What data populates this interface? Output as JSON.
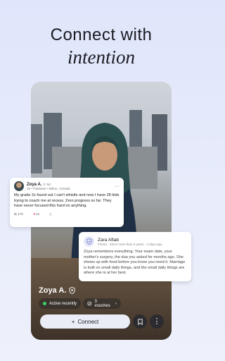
{
  "headline": {
    "line1": "Connect with",
    "line2": "intention"
  },
  "post": {
    "author": "Zoya A.",
    "time": "5d",
    "meta": "25 • Pakistani • Milton, Canada",
    "body": "My grade 2s found out I can't whistle and now I have 28 kids trying to coach me at recess. Zero progress so far. They have never focused this hard on anything.",
    "views": "17K",
    "likes": "61"
  },
  "comment": {
    "author": "Zara Aftab",
    "meta": "Friend · Since more than 5 years · 4 days ago",
    "body": "Zoya remembers everything. Your exam date, your mother's surgery, the dua you asked for months ago. She shows up with food before you know you need it. Marriage is built on small daily things, and the small daily things are where she is at her best."
  },
  "profile": {
    "name": "Zoya A.",
    "status": "Active recently",
    "vouches": "3 vouches",
    "status_color": "#3ad46a"
  },
  "actions": {
    "connect_label": "Connect",
    "connect_icon": "plus-icon",
    "bookmark_icon": "bookmark-icon",
    "more_icon": "more-vertical-icon"
  }
}
